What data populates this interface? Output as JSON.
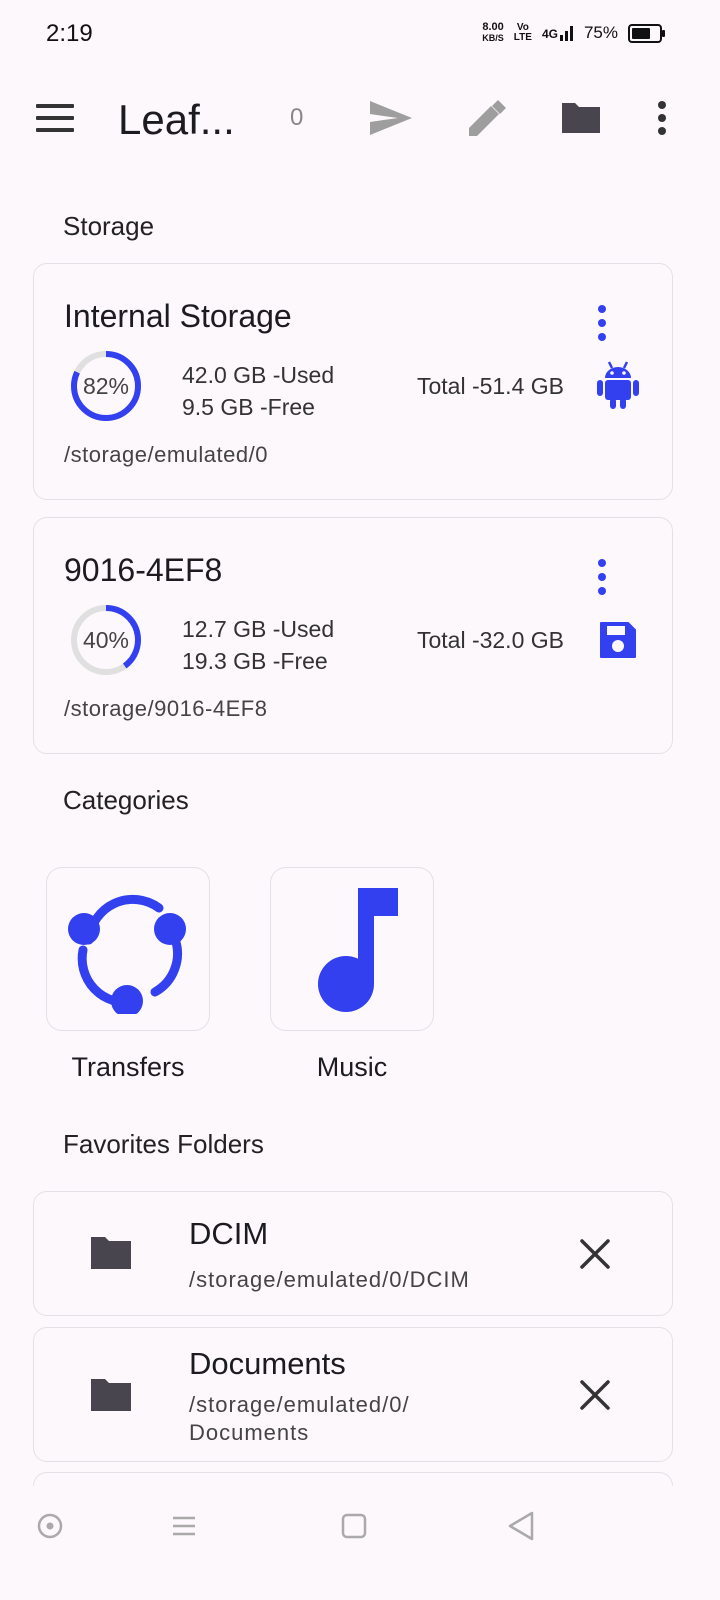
{
  "status_bar": {
    "time": "2:19",
    "net_speed_value": "8.00",
    "net_speed_unit": "KB/S",
    "volte_top": "Vo",
    "volte_bottom": "LTE",
    "signal": "4G",
    "battery_percent": "75%",
    "battery_level": 0.75
  },
  "toolbar": {
    "title": "Leaf...",
    "count": "0",
    "icons": [
      "menu-icon",
      "send-icon",
      "edit-icon",
      "folder-icon",
      "more-vert-icon"
    ]
  },
  "storage_section": {
    "label": "Storage",
    "cards": [
      {
        "title": "Internal Storage",
        "percent_label": "82%",
        "percent": 0.82,
        "used": "42.0 GB -Used",
        "free": "9.5 GB -Free",
        "total": "Total -51.4 GB",
        "path": "/storage/emulated/0",
        "icon": "android-icon"
      },
      {
        "title": "9016-4EF8",
        "percent_label": "40%",
        "percent": 0.4,
        "used": "12.7 GB -Used",
        "free": "19.3 GB -Free",
        "total": "Total -32.0 GB",
        "path": "/storage/9016-4EF8",
        "icon": "sd-card-save-icon"
      }
    ]
  },
  "categories_section": {
    "label": "Categories",
    "items": [
      {
        "label": "Transfers",
        "icon": "transfers-icon"
      },
      {
        "label": "Music",
        "icon": "music-note-icon"
      }
    ]
  },
  "favorites_section": {
    "label": "Favorites Folders",
    "items": [
      {
        "name": "DCIM",
        "path": "/storage/emulated/0/DCIM"
      },
      {
        "name": "Documents",
        "path_line1": "/storage/emulated/0/",
        "path_line2": "Documents"
      }
    ]
  },
  "colors": {
    "accent": "#3340f0",
    "background": "#fdf8fb",
    "icon_gray": "#49454f",
    "icon_light_gray": "#9e9e9e",
    "track": "#e0e0e0"
  }
}
